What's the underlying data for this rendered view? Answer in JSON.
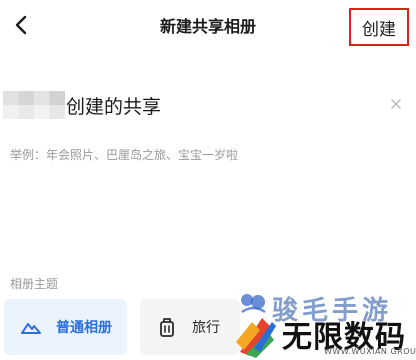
{
  "nav": {
    "title": "新建共享相册",
    "create_label": "创建"
  },
  "album_name": {
    "value_suffix": "创建的共享"
  },
  "hint": "举例：年会照片、巴厘岛之旅、宝宝一岁啦",
  "theme": {
    "label": "相册主题",
    "options": [
      {
        "label": "普通相册",
        "icon": "mountain-icon",
        "selected": true
      },
      {
        "label": "旅行",
        "icon": "luggage-icon",
        "selected": false
      }
    ]
  },
  "watermark": {
    "top_text": "骏毛手游",
    "main_text": "无限数码",
    "sub_text": "WWW.WUXIAN GROUP"
  },
  "colors": {
    "accent": "#2a6fdb",
    "selected_bg": "#eaf3fe",
    "highlight_border": "#e0211a"
  }
}
